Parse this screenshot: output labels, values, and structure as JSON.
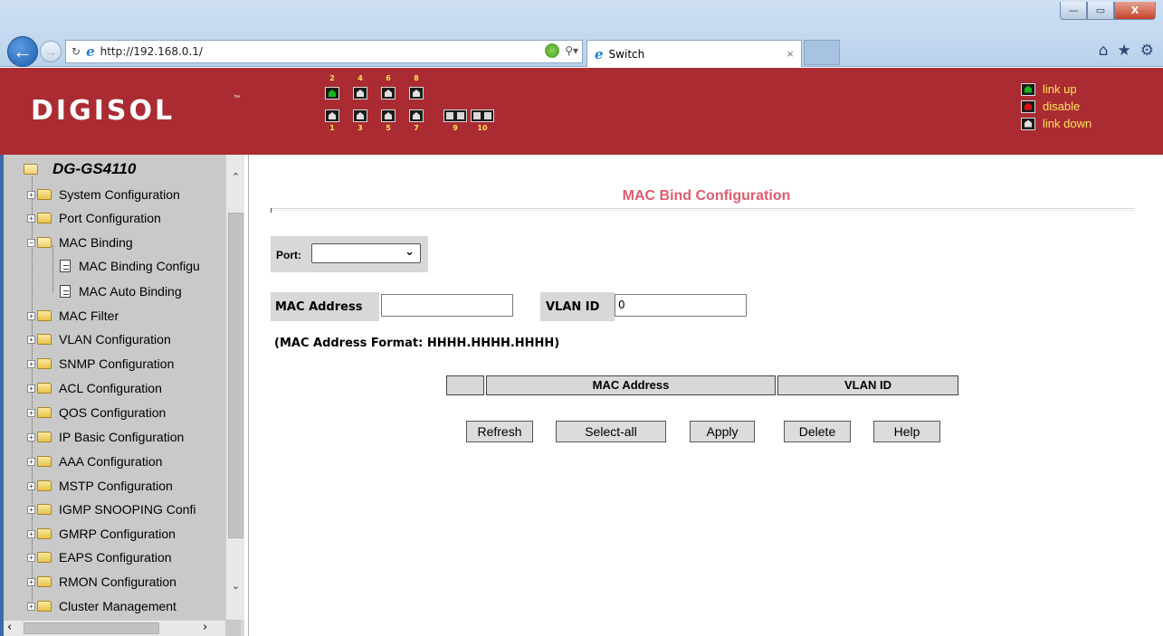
{
  "browser": {
    "url": "http://192.168.0.1/",
    "tab_title": "Switch",
    "tab_close": "×",
    "win_minimize": "—",
    "win_restore": "▭",
    "win_close": "X",
    "address_icons": [
      "refresh-icon",
      "ie-logo-icon",
      "compatibility-icon",
      "search-icon"
    ],
    "toolbar_icons": [
      "home-icon",
      "favorites-star-icon",
      "settings-gear-icon"
    ]
  },
  "header": {
    "brand": "DIGISOL",
    "brand_tm": "™",
    "ports_top": [
      {
        "num": "2",
        "state": "up"
      },
      {
        "num": "4",
        "state": "down"
      },
      {
        "num": "6",
        "state": "down"
      },
      {
        "num": "8",
        "state": "down"
      }
    ],
    "ports_bottom": [
      {
        "num": "1",
        "state": "down"
      },
      {
        "num": "3",
        "state": "down"
      },
      {
        "num": "5",
        "state": "down"
      },
      {
        "num": "7",
        "state": "down"
      }
    ],
    "fiber_ports": [
      "9",
      "10"
    ],
    "legend": [
      {
        "label": "link up",
        "state": "up"
      },
      {
        "label": "disable",
        "state": "disable"
      },
      {
        "label": "link down",
        "state": "down"
      }
    ],
    "colors": {
      "background": "#ab2b32",
      "port_numbers": "#ffe45c",
      "link_up": "#16b51a",
      "disable": "#e01010"
    }
  },
  "sidebar": {
    "root": "DG-GS4110",
    "items": [
      {
        "label": "System Configuration",
        "type": "folder",
        "expanded": false
      },
      {
        "label": "Port Configuration",
        "type": "folder",
        "expanded": false
      },
      {
        "label": "MAC Binding",
        "type": "folder",
        "expanded": true
      },
      {
        "label": "MAC Binding Configu",
        "type": "page",
        "child": true
      },
      {
        "label": "MAC Auto Binding",
        "type": "page",
        "child": true
      },
      {
        "label": "MAC Filter",
        "type": "folder",
        "expanded": false
      },
      {
        "label": "VLAN Configuration",
        "type": "folder",
        "expanded": false
      },
      {
        "label": "SNMP Configuration",
        "type": "folder",
        "expanded": false
      },
      {
        "label": "ACL Configuration",
        "type": "folder",
        "expanded": false
      },
      {
        "label": "QOS Configuration",
        "type": "folder",
        "expanded": false
      },
      {
        "label": "IP Basic Configuration",
        "type": "folder",
        "expanded": false
      },
      {
        "label": "AAA Configuration",
        "type": "folder",
        "expanded": false
      },
      {
        "label": "MSTP Configuration",
        "type": "folder",
        "expanded": false
      },
      {
        "label": "IGMP SNOOPING Confi",
        "type": "folder",
        "expanded": false
      },
      {
        "label": "GMRP Configuration",
        "type": "folder",
        "expanded": false
      },
      {
        "label": "EAPS Configuration",
        "type": "folder",
        "expanded": false
      },
      {
        "label": "RMON Configuration",
        "type": "folder",
        "expanded": false
      },
      {
        "label": "Cluster Management",
        "type": "folder",
        "expanded": false
      }
    ]
  },
  "main": {
    "title": "MAC Bind Configuration",
    "port_label": "Port:",
    "port_value": "",
    "mac_label": "MAC Address",
    "mac_value": "",
    "vlan_label": "VLAN ID",
    "vlan_value": "0",
    "format_note": "(MAC Address Format: HHHH.HHHH.HHHH)",
    "table_headers": [
      "",
      "MAC Address",
      "VLAN ID"
    ],
    "buttons": [
      "Refresh",
      "Select-all",
      "Apply",
      "Delete",
      "Help"
    ]
  }
}
